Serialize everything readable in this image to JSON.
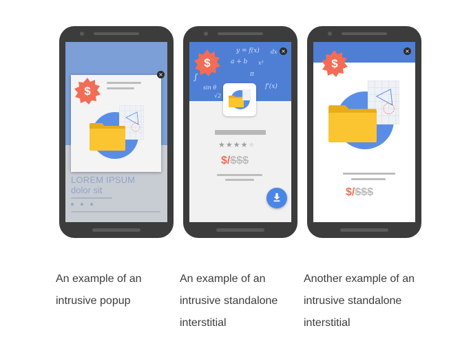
{
  "colors": {
    "badge": "#f36c55",
    "blue": "#5c8fe0",
    "folder": "#fbc531",
    "circle": "#5a8ee6",
    "phone": "#3c3c3c"
  },
  "icons": {
    "badge": "dollar-badge-icon",
    "close": "close-icon",
    "download": "download-icon",
    "star": "star-icon",
    "folder": "folder-icon"
  },
  "phones": [
    {
      "bg_title": "LOREM IPSUM",
      "bg_subtitle": "dolor sit",
      "badge_glyph": "$",
      "close_glyph": "×",
      "caption": [
        "An example of an",
        "intrusive popup"
      ]
    },
    {
      "badge_glyph": "$",
      "close_glyph": "×",
      "math": [
        "y = f(x)",
        "a + b",
        "f'(x)",
        "∫",
        "x²",
        "sin θ",
        "dx",
        "π",
        "√2"
      ],
      "rating": 4,
      "rating_max": 5,
      "price_now": "$/",
      "price_was": "$$$",
      "download_glyph": "⬇",
      "caption": [
        "An example of an",
        "intrusive standalone",
        "interstitial"
      ]
    },
    {
      "badge_glyph": "$",
      "close_glyph": "×",
      "price_now": "$/",
      "price_was": "$$$",
      "caption": [
        "Another example of an",
        "intrusive standalone",
        "interstitial"
      ]
    }
  ]
}
